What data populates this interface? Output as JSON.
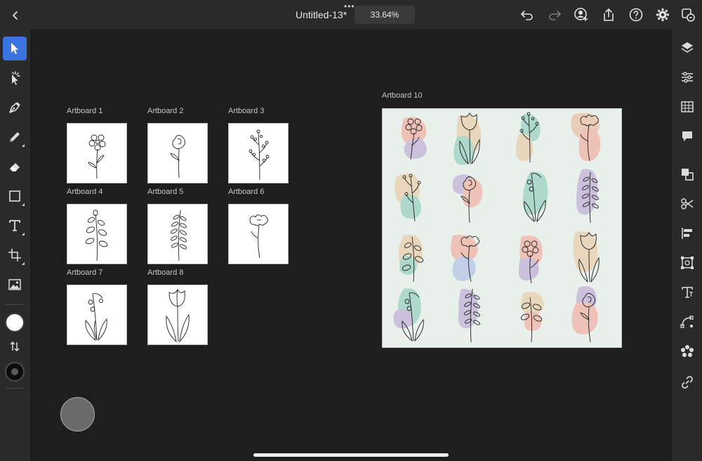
{
  "document": {
    "title": "Untitled-13*",
    "zoom": "33.64%"
  },
  "toolbar_top": {
    "icons": [
      "back-icon",
      "more-dots-icon",
      "undo-icon",
      "redo-icon",
      "invite-user-icon",
      "share-icon",
      "help-icon",
      "settings-gear-icon",
      "switch-view-icon"
    ]
  },
  "tools_left": [
    "selection-tool-icon",
    "direct-selection-tool-icon",
    "pen-tool-icon",
    "pencil-tool-icon",
    "eraser-tool-icon",
    "rectangle-tool-icon",
    "type-tool-icon",
    "artboard-tool-icon",
    "place-image-icon"
  ],
  "colors": {
    "fill": "#ffffff",
    "stroke": "#0c0c0c",
    "accent": "#3b73e0"
  },
  "panels_right": [
    "layers-icon",
    "properties-icon",
    "swatches-icon",
    "comments-icon",
    "arrange-icon",
    "scissors-icon",
    "align-icon",
    "transform-icon",
    "type-panel-icon",
    "path-icon",
    "repeat-icon",
    "link-icon"
  ],
  "artboards": [
    {
      "label": "Artboard 1",
      "art": "daisy"
    },
    {
      "label": "Artboard 2",
      "art": "rose"
    },
    {
      "label": "Artboard 3",
      "art": "berries"
    },
    {
      "label": "Artboard 4",
      "art": "eucalyptus"
    },
    {
      "label": "Artboard 5",
      "art": "fern"
    },
    {
      "label": "Artboard 6",
      "art": "cosmos"
    },
    {
      "label": "Artboard 7",
      "art": "lily-of-valley"
    },
    {
      "label": "Artboard 8",
      "art": "tulip"
    }
  ],
  "artboard_main": {
    "label": "Artboard 10",
    "background": "#e9f0eb",
    "blob_colors": [
      "#e9c7b5",
      "#c4b6da",
      "#9fd3c4",
      "#f0b7a9",
      "#e8d2b1",
      "#b9c7e6"
    ]
  }
}
